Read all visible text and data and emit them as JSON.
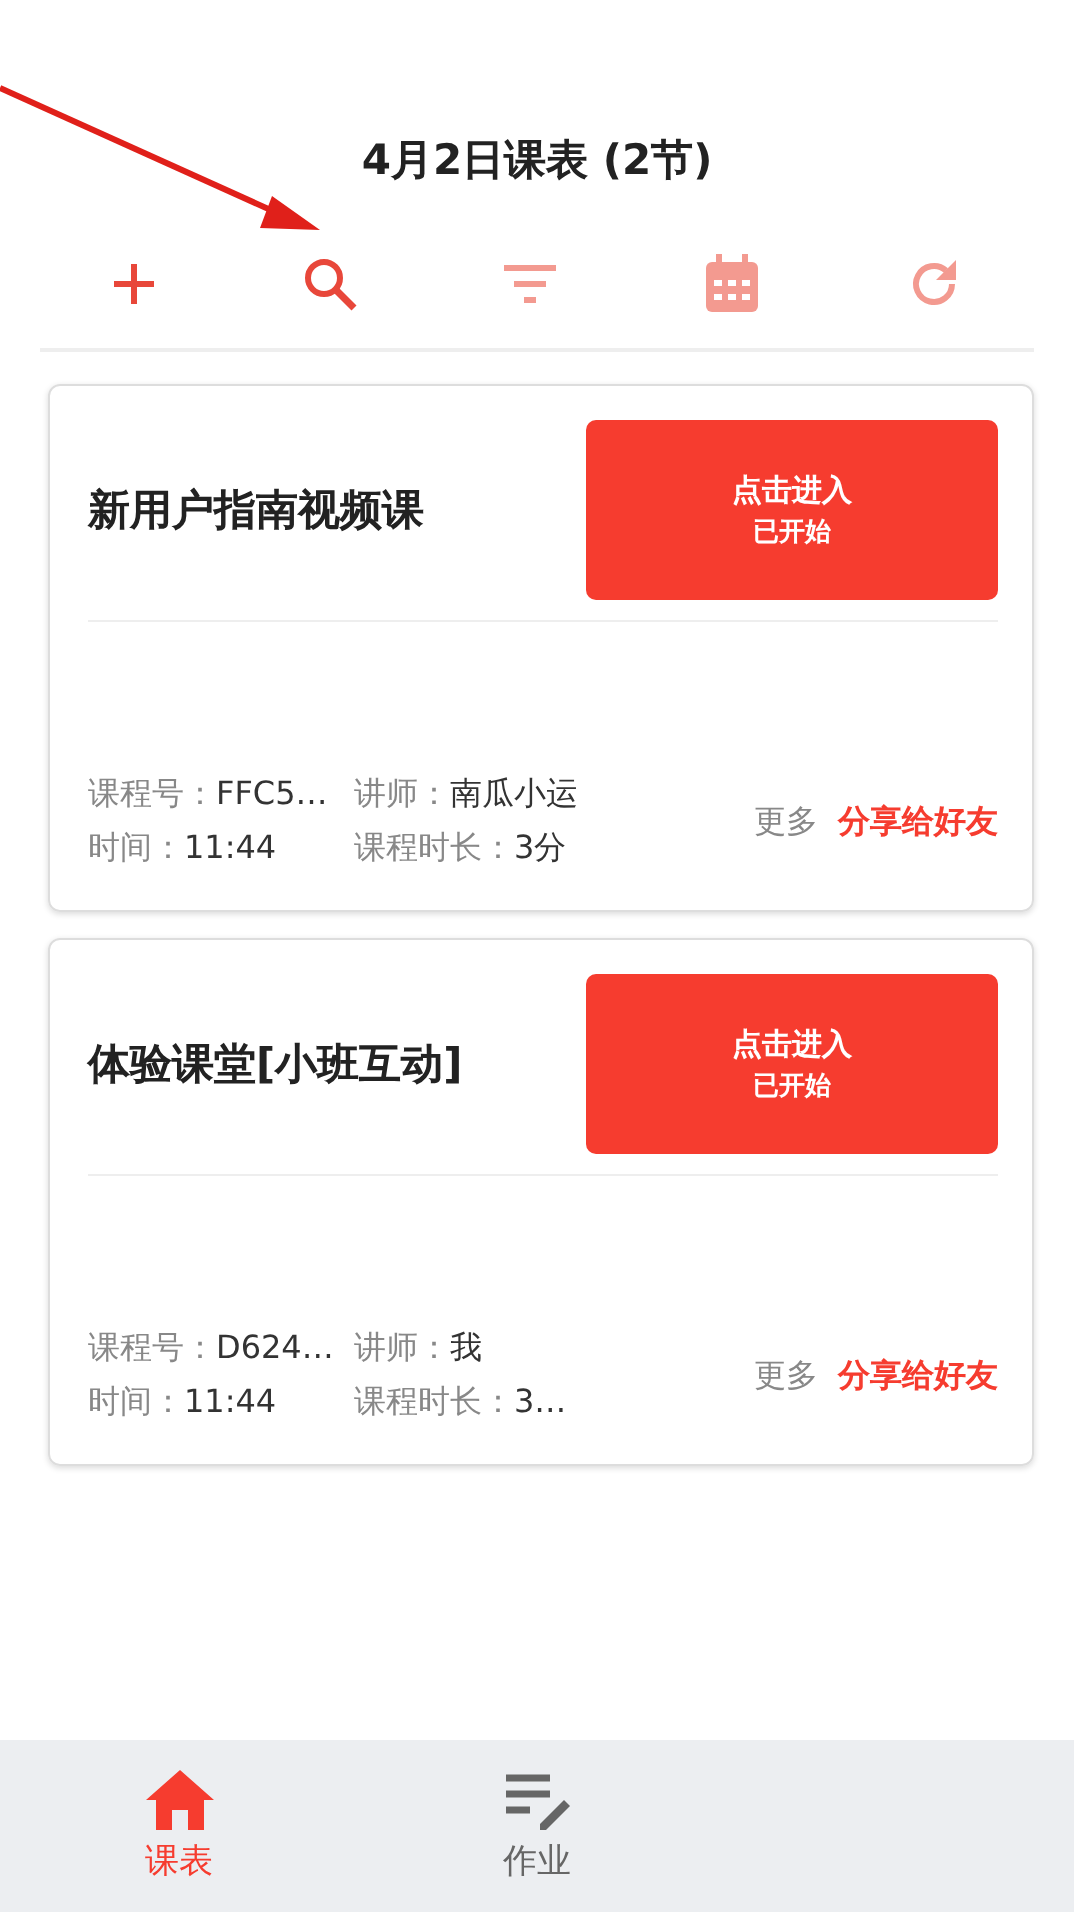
{
  "header": {
    "title": "4月2日课表 (2节)"
  },
  "toolbar": [
    {
      "kind": "add",
      "disabled": false
    },
    {
      "kind": "search",
      "disabled": false
    },
    {
      "kind": "filter",
      "disabled": true
    },
    {
      "kind": "calendar",
      "disabled": true
    },
    {
      "kind": "refresh",
      "disabled": true
    }
  ],
  "courses": [
    {
      "title": "新用户指南视频课",
      "enter_button": {
        "label": "点击进入",
        "status": "已开始"
      },
      "course_no_label": "课程号：",
      "course_no": "FFC5…",
      "teacher_label": "讲师：",
      "teacher": "南瓜小运",
      "time_label": "时间：",
      "time": "11:44",
      "duration_label": "课程时长：",
      "duration": "3分",
      "more": "更多",
      "share": "分享给好友"
    },
    {
      "title": "体验课堂[小班互动]",
      "enter_button": {
        "label": "点击进入",
        "status": "已开始"
      },
      "course_no_label": "课程号：",
      "course_no": "D624…",
      "teacher_label": "讲师：",
      "teacher": "我",
      "time_label": "时间：",
      "time": "11:44",
      "duration_label": "课程时长：",
      "duration": "3…",
      "more": "更多",
      "share": "分享给好友"
    }
  ],
  "bottom_nav": [
    {
      "kind": "home",
      "label": "课表",
      "selected": true
    },
    {
      "kind": "homework",
      "label": "作业",
      "selected": false
    }
  ]
}
